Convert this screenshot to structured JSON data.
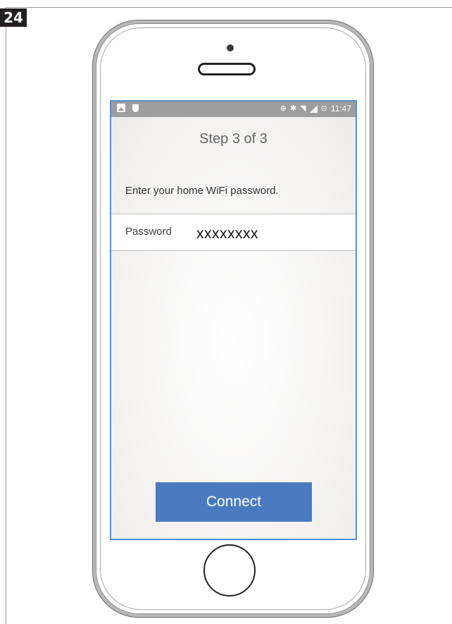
{
  "figure_number": "24",
  "status_bar": {
    "time": "11:47",
    "left_icons": [
      "image-icon",
      "shield-icon"
    ],
    "right_icons": [
      "sync-icon",
      "bluetooth-icon",
      "wifi-icon",
      "signal-icon",
      "alarm-icon"
    ]
  },
  "screen": {
    "step_title": "Step 3 of 3",
    "instruction": "Enter your home WiFi password.",
    "password_field": {
      "label": "Password",
      "value": "xxxxxxxx"
    },
    "connect_button": "Connect"
  },
  "colors": {
    "accent": "#4a7bc0",
    "screen_border": "#5b8fd1",
    "status_bar": "#9e9e9e"
  }
}
